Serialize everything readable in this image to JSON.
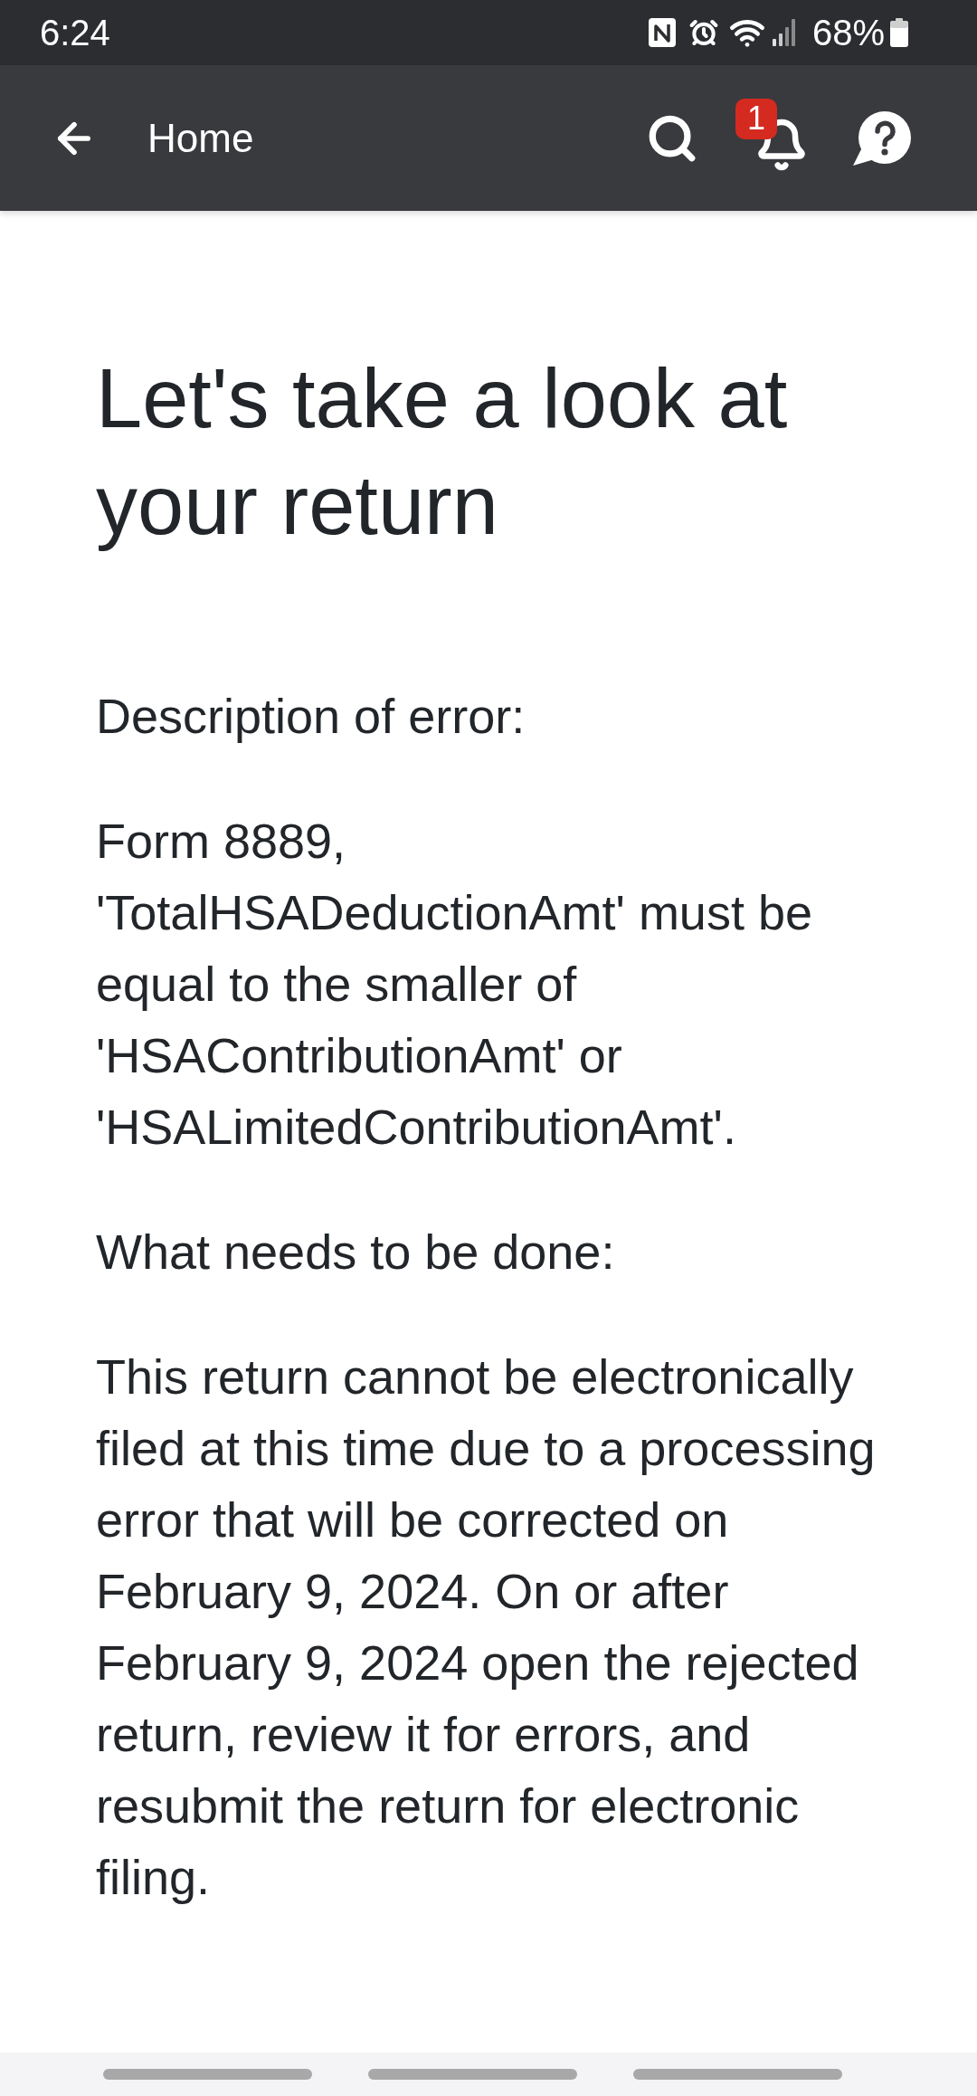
{
  "status_bar": {
    "time": "6:24",
    "battery": "68%"
  },
  "app_bar": {
    "title": "Home",
    "notification_badge": "1"
  },
  "heading": "Let's take a look at your return",
  "sections": [
    {
      "label": "Description of error:",
      "body": "Form 8889, 'TotalHSADeductionAmt' must be equal to the smaller of 'HSAContributionAmt' or 'HSALimitedContributionAmt'."
    },
    {
      "label": "What needs to be done:",
      "body": "This return cannot be electronically filed at this time due to a processing error that will be corrected on February 9, 2024. On or after February 9, 2024 open the rejected return, review it for errors, and resubmit the return for electronic filing."
    }
  ]
}
